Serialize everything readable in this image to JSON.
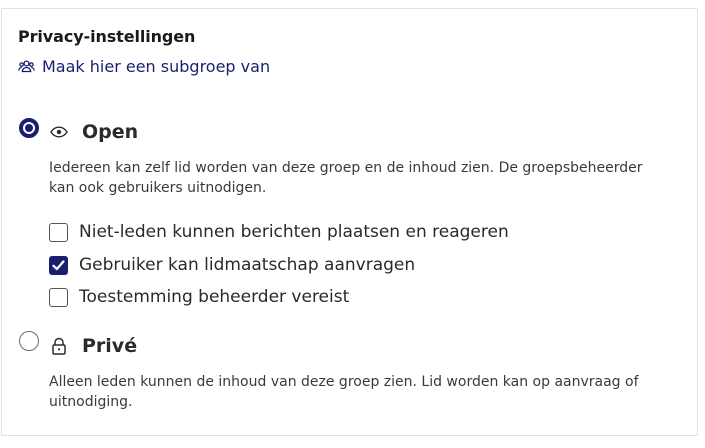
{
  "privacy": {
    "title": "Privacy-instellingen",
    "subgroup_link": "Maak hier een subgroep van",
    "options": [
      {
        "title": "Open",
        "selected": true,
        "icon": "eye-icon",
        "description": "Iedereen kan zelf lid worden van deze groep en de inhoud zien. De groepsbeheerder kan ook gebruikers uitnodigen.",
        "checkboxes": [
          {
            "label": "Niet-leden kunnen berichten plaatsen en reageren",
            "checked": false
          },
          {
            "label": "Gebruiker kan lidmaatschap aanvragen",
            "checked": true
          },
          {
            "label": "Toestemming beheerder vereist",
            "checked": false
          }
        ]
      },
      {
        "title": "Privé",
        "selected": false,
        "icon": "lock-icon",
        "description": "Alleen leden kunnen de inhoud van deze groep zien. Lid worden kan op aanvraag of uitnodiging."
      }
    ]
  },
  "colors": {
    "accent": "#1b1e6e",
    "text": "#2a2a2a",
    "border": "#e1e1e1"
  }
}
